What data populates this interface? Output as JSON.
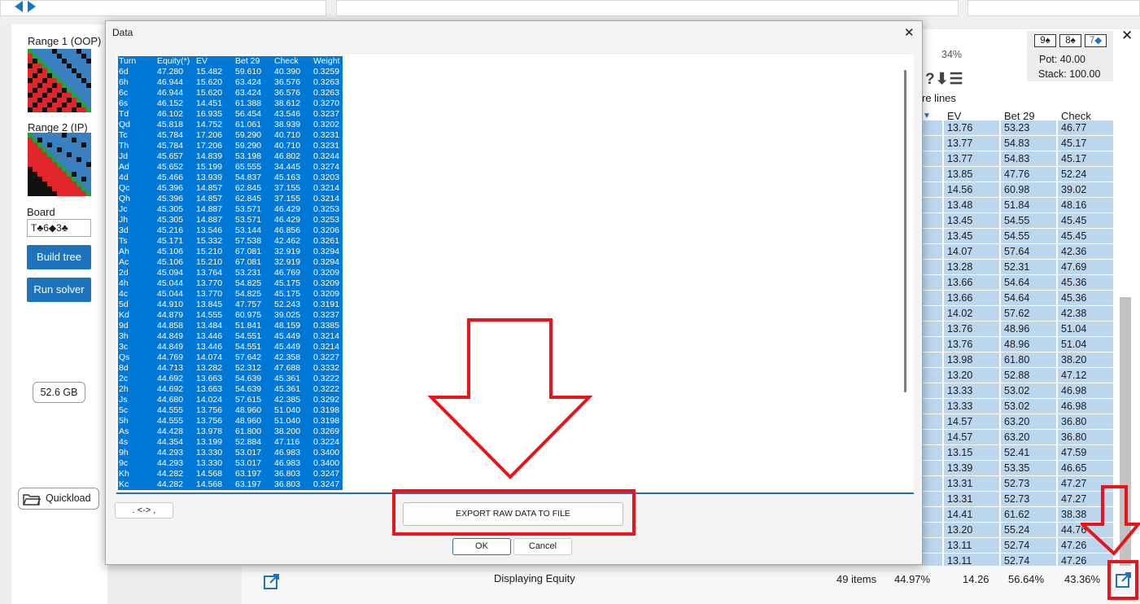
{
  "left_panel": {
    "range1_label": "Range 1 (OOP)",
    "range2_label": "Range 2 (IP)",
    "board_label": "Board",
    "board_value": "T♣6◆3♣",
    "build_tree": "Build tree",
    "run_solver": "Run solver",
    "memory": "52.6 GB",
    "quickload": "Quickload"
  },
  "right_panel": {
    "board_cards": [
      "9♠",
      "8♠",
      "7◆"
    ],
    "pot": "Pot: 40.00",
    "stack": "Stack: 100.00",
    "percent": "34%",
    "icons": "?⬇☰",
    "more_lines": "re lines",
    "headers": [
      "EV",
      "Bet 29",
      "Check"
    ],
    "rows": [
      [
        "13.76",
        "53.23",
        "46.77"
      ],
      [
        "13.77",
        "54.83",
        "45.17"
      ],
      [
        "13.77",
        "54.83",
        "45.17"
      ],
      [
        "13.85",
        "47.76",
        "52.24"
      ],
      [
        "14.56",
        "60.98",
        "39.02"
      ],
      [
        "13.48",
        "51.84",
        "48.16"
      ],
      [
        "13.45",
        "54.55",
        "45.45"
      ],
      [
        "13.45",
        "54.55",
        "45.45"
      ],
      [
        "14.07",
        "57.64",
        "42.36"
      ],
      [
        "13.28",
        "52.31",
        "47.69"
      ],
      [
        "13.66",
        "54.64",
        "45.36"
      ],
      [
        "13.66",
        "54.64",
        "45.36"
      ],
      [
        "14.02",
        "57.62",
        "42.38"
      ],
      [
        "13.76",
        "48.96",
        "51.04"
      ],
      [
        "13.76",
        "48.96",
        "51.04"
      ],
      [
        "13.98",
        "61.80",
        "38.20"
      ],
      [
        "13.20",
        "52.88",
        "47.12"
      ],
      [
        "13.33",
        "53.02",
        "46.98"
      ],
      [
        "13.33",
        "53.02",
        "46.98"
      ],
      [
        "14.57",
        "63.20",
        "36.80"
      ],
      [
        "14.57",
        "63.20",
        "36.80"
      ],
      [
        "13.15",
        "52.41",
        "47.59"
      ],
      [
        "13.39",
        "53.35",
        "46.65"
      ],
      [
        "13.31",
        "52.73",
        "47.27"
      ],
      [
        "13.31",
        "52.73",
        "47.27"
      ],
      [
        "14.41",
        "61.62",
        "38.38"
      ],
      [
        "13.20",
        "55.24",
        "44.76"
      ],
      [
        "13.11",
        "52.74",
        "47.26"
      ],
      [
        "13.11",
        "52.74",
        "47.26"
      ]
    ],
    "footer": {
      "displaying": "Displaying Equity",
      "items": "49 items",
      "equity": "44.97%",
      "ev": "14.26",
      "bet": "56.64%",
      "check": "43.36%"
    }
  },
  "dialog": {
    "title": "Data",
    "close": "✕",
    "columns": [
      "Turn",
      "Equity(*)",
      "EV",
      "Bet 29",
      "Check",
      "Weight"
    ],
    "rows": [
      [
        "6d",
        "47.280",
        "15.482",
        "59.610",
        "40.390",
        "0.3259"
      ],
      [
        "6h",
        "46.944",
        "15.620",
        "63.424",
        "36.576",
        "0.3263"
      ],
      [
        "6c",
        "46.944",
        "15.620",
        "63.424",
        "36.576",
        "0.3263"
      ],
      [
        "6s",
        "46.152",
        "14.451",
        "61.388",
        "38.612",
        "0.3270"
      ],
      [
        "Td",
        "46.102",
        "16.935",
        "56.454",
        "43.546",
        "0.3237"
      ],
      [
        "Qd",
        "45.818",
        "14.752",
        "61.061",
        "38.939",
        "0.3202"
      ],
      [
        "Tc",
        "45.784",
        "17.206",
        "59.290",
        "40.710",
        "0.3231"
      ],
      [
        "Th",
        "45.784",
        "17.206",
        "59.290",
        "40.710",
        "0.3231"
      ],
      [
        "Jd",
        "45.657",
        "14.839",
        "53.198",
        "46.802",
        "0.3244"
      ],
      [
        "Ad",
        "45.652",
        "15.199",
        "65.555",
        "34.445",
        "0.3274"
      ],
      [
        "4d",
        "45.466",
        "13.939",
        "54.837",
        "45.163",
        "0.3203"
      ],
      [
        "Qc",
        "45.396",
        "14.857",
        "62.845",
        "37.155",
        "0.3214"
      ],
      [
        "Qh",
        "45.396",
        "14.857",
        "62.845",
        "37.155",
        "0.3214"
      ],
      [
        "Jc",
        "45.305",
        "14.887",
        "53.571",
        "46.429",
        "0.3253"
      ],
      [
        "Jh",
        "45.305",
        "14.887",
        "53.571",
        "46.429",
        "0.3253"
      ],
      [
        "3d",
        "45.216",
        "13.546",
        "53.144",
        "46.856",
        "0.3206"
      ],
      [
        "Ts",
        "45.171",
        "15.332",
        "57.538",
        "42.462",
        "0.3261"
      ],
      [
        "Ah",
        "45.106",
        "15.210",
        "67.081",
        "32.919",
        "0.3294"
      ],
      [
        "Ac",
        "45.106",
        "15.210",
        "67.081",
        "32.919",
        "0.3294"
      ],
      [
        "2d",
        "45.094",
        "13.764",
        "53.231",
        "46.769",
        "0.3209"
      ],
      [
        "4h",
        "45.044",
        "13.770",
        "54.825",
        "45.175",
        "0.3209"
      ],
      [
        "4c",
        "45.044",
        "13.770",
        "54.825",
        "45.175",
        "0.3209"
      ],
      [
        "5d",
        "44.910",
        "13.845",
        "47.757",
        "52.243",
        "0.3191"
      ],
      [
        "Kd",
        "44.879",
        "14.555",
        "60.975",
        "39.025",
        "0.3237"
      ],
      [
        "9d",
        "44.858",
        "13.484",
        "51.841",
        "48.159",
        "0.3385"
      ],
      [
        "3h",
        "44.849",
        "13.446",
        "54.551",
        "45.449",
        "0.3214"
      ],
      [
        "3c",
        "44.849",
        "13.446",
        "54.551",
        "45.449",
        "0.3214"
      ],
      [
        "Qs",
        "44.769",
        "14.074",
        "57.642",
        "42.358",
        "0.3227"
      ],
      [
        "8d",
        "44.713",
        "13.282",
        "52.312",
        "47.688",
        "0.3332"
      ],
      [
        "2c",
        "44.692",
        "13.663",
        "54.639",
        "45.361",
        "0.3222"
      ],
      [
        "2h",
        "44.692",
        "13.663",
        "54.639",
        "45.361",
        "0.3222"
      ],
      [
        "Js",
        "44.680",
        "14.024",
        "57.615",
        "42.385",
        "0.3292"
      ],
      [
        "5c",
        "44.555",
        "13.756",
        "48.960",
        "51.040",
        "0.3198"
      ],
      [
        "5h",
        "44.555",
        "13.756",
        "48.960",
        "51.040",
        "0.3198"
      ],
      [
        "As",
        "44.428",
        "13.978",
        "61.800",
        "38.200",
        "0.3269"
      ],
      [
        "4s",
        "44.354",
        "13.199",
        "52.884",
        "47.116",
        "0.3224"
      ],
      [
        "9h",
        "44.293",
        "13.330",
        "53.017",
        "46.983",
        "0.3400"
      ],
      [
        "9c",
        "44.293",
        "13.330",
        "53.017",
        "46.983",
        "0.3400"
      ],
      [
        "Kh",
        "44.282",
        "14.568",
        "63.197",
        "36.803",
        "0.3247"
      ],
      [
        "Kc",
        "44.282",
        "14.568",
        "63.197",
        "36.803",
        "0.3247"
      ]
    ],
    "separator_btn": ". <-> ,",
    "export_btn": "EXPORT RAW DATA TO FILE",
    "ok": "OK",
    "cancel": "Cancel"
  },
  "colors": {
    "highlight": "#0078d7",
    "accent_red": "#e8141c",
    "button_blue": "#1e73be",
    "cell_blue": "#bcd6ee"
  }
}
